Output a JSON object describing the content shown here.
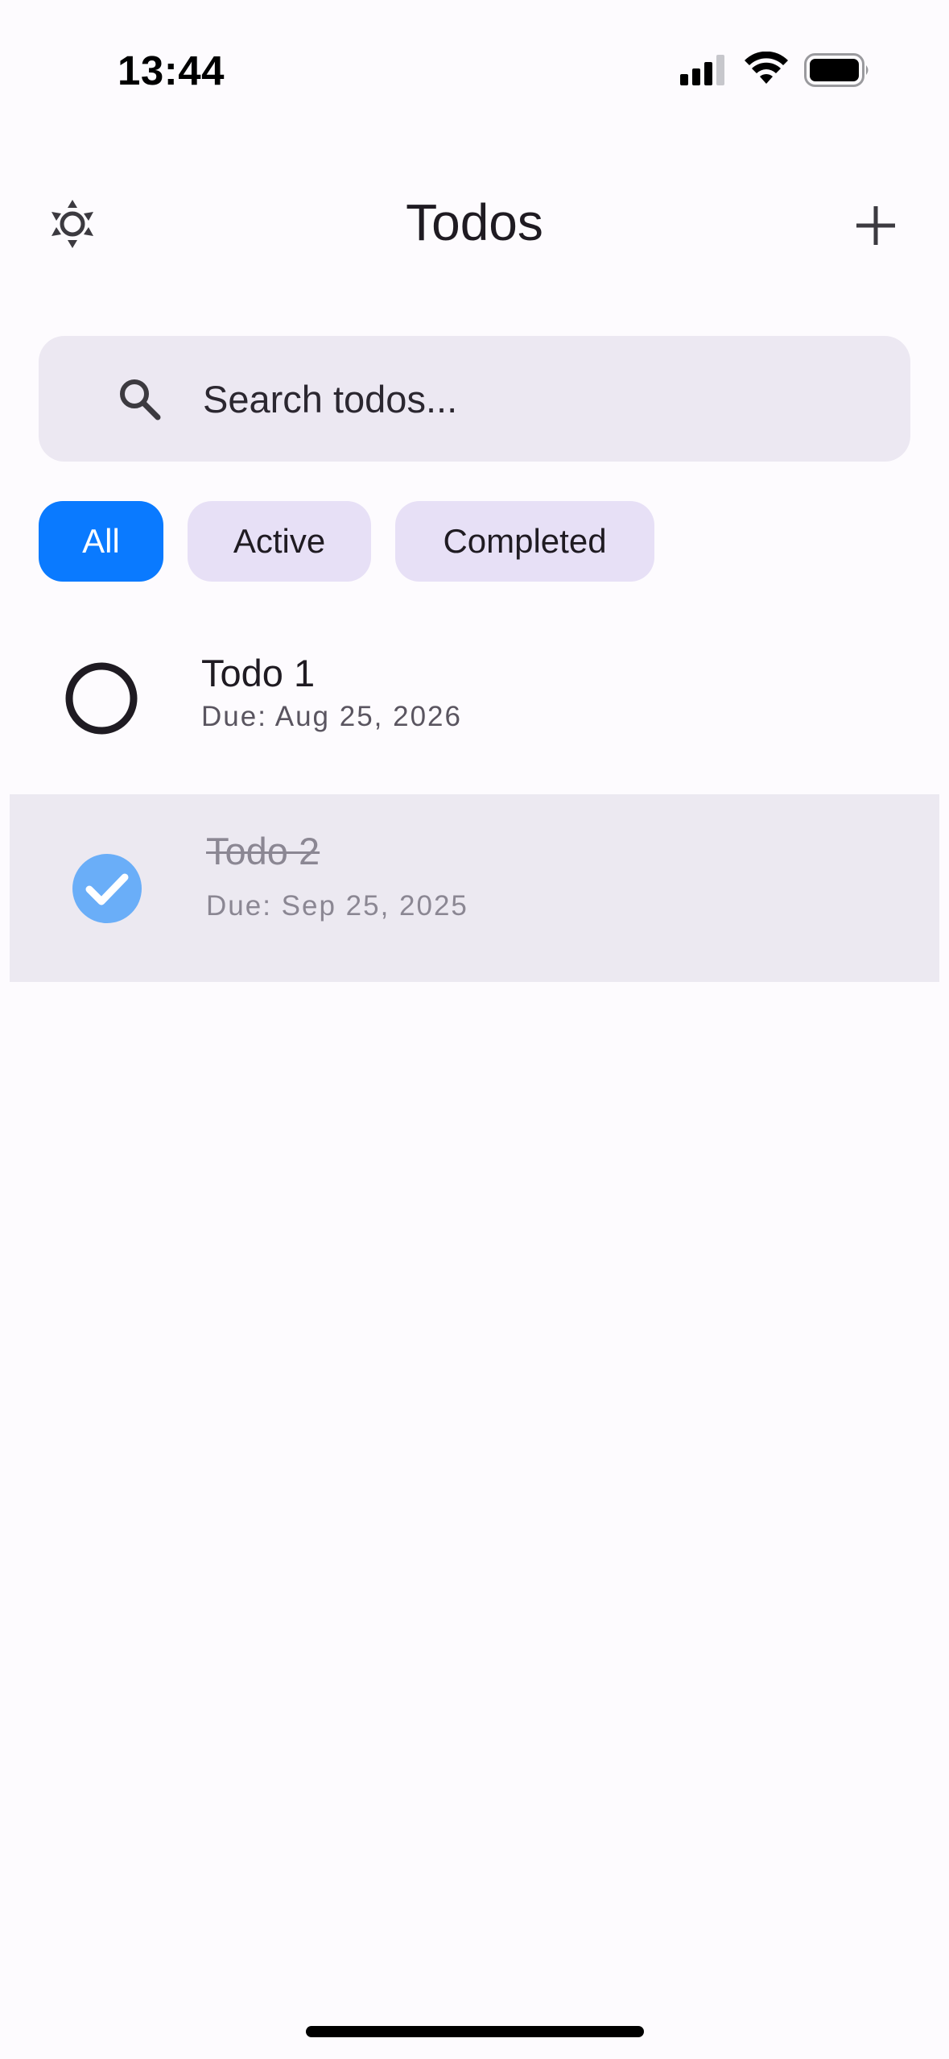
{
  "status_bar": {
    "time": "13:44",
    "icons": [
      "signal-icon",
      "wifi-icon",
      "battery-icon"
    ]
  },
  "header": {
    "title": "Todos",
    "left_icon": "brightness-icon",
    "right_icon": "plus-icon"
  },
  "search": {
    "placeholder": "Search todos...",
    "value": "",
    "icon": "search-icon"
  },
  "filters": {
    "selected": "All",
    "items": [
      {
        "label": "All"
      },
      {
        "label": "Active"
      },
      {
        "label": "Completed"
      }
    ]
  },
  "todos": [
    {
      "title": "Todo 1",
      "due": "Due: Aug 25, 2026",
      "completed": false
    },
    {
      "title": "Todo 2",
      "due": "Due: Sep 25, 2025",
      "completed": true
    }
  ],
  "colors": {
    "accent": "#0a7aff",
    "chip_bg": "#e7e0f6",
    "search_bg": "#ece8f2",
    "completed_row_bg": "#ece9f1",
    "check_fill": "#6aaef8",
    "page_bg": "#fdfbfe"
  }
}
